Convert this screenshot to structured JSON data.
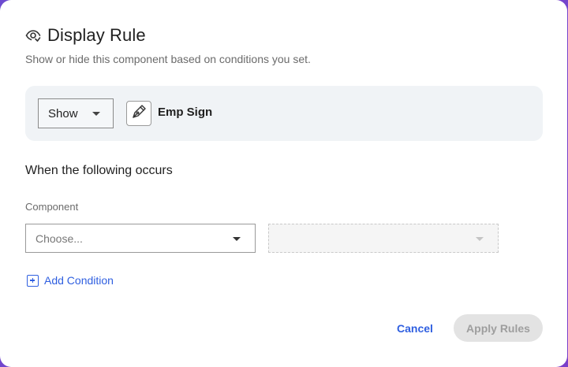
{
  "dialog": {
    "title": "Display Rule",
    "subtitle": "Show or hide this component based on conditions you set.",
    "title_icon": "eye-icon"
  },
  "rule": {
    "mode_value": "Show",
    "component_icon": "pen-nib-icon",
    "component_name": "Emp Sign"
  },
  "conditions": {
    "section_title": "When the following occurs",
    "component_label": "Component",
    "component_placeholder": "Choose...",
    "value_placeholder": ""
  },
  "actions": {
    "add_condition": "Add Condition",
    "cancel": "Cancel",
    "apply": "Apply Rules"
  },
  "colors": {
    "accent": "#2f5fe0",
    "panel_bg": "#f0f3f6",
    "disabled_bg": "#e3e3e3"
  }
}
